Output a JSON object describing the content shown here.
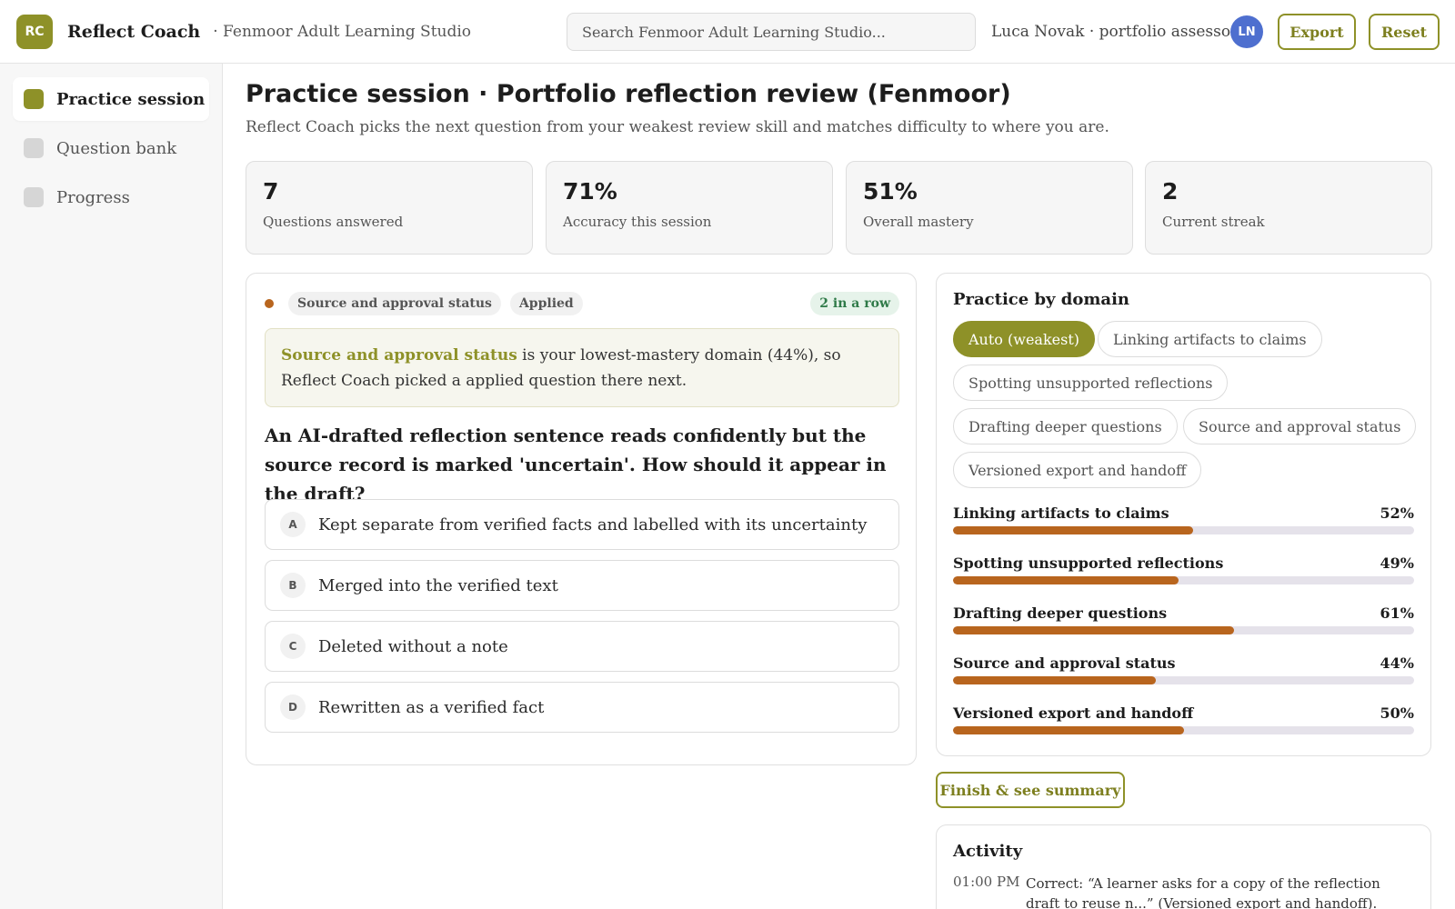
{
  "header": {
    "logo_text": "RC",
    "app_title": "Reflect Coach",
    "org": "· Fenmoor Adult Learning Studio",
    "search_placeholder": "Search Fenmoor Adult Learning Studio...",
    "user": "Luca Novak · portfolio assessor",
    "avatar": "LN",
    "export_label": "Export",
    "reset_label": "Reset"
  },
  "sidebar": {
    "items": [
      {
        "label": "Practice session",
        "icon": "practice-icon",
        "active": true
      },
      {
        "label": "Question bank",
        "icon": "bank-icon",
        "active": false
      },
      {
        "label": "Progress",
        "icon": "progress-icon",
        "active": false
      }
    ]
  },
  "page": {
    "title": "Practice session · Portfolio reflection review (Fenmoor)",
    "subtitle": "Reflect Coach picks the next question from your weakest review skill and matches difficulty to where you are."
  },
  "stats": [
    {
      "value": "7",
      "label": "Questions answered"
    },
    {
      "value": "71%",
      "label": "Accuracy this session"
    },
    {
      "value": "51%",
      "label": "Overall mastery"
    },
    {
      "value": "2",
      "label": "Current streak"
    }
  ],
  "question": {
    "domain_chip": "Source and approval status",
    "level_chip": "Applied",
    "streak": "2 in a row",
    "reason_highlight": "Source and approval status",
    "reason_rest": " is your lowest-mastery domain (44%), so Reflect Coach picked a applied question there next.",
    "text": "An AI-drafted reflection sentence reads confidently but the source record is marked 'uncertain'. How should it appear in the draft?",
    "options": [
      {
        "letter": "A",
        "text": "Kept separate from verified facts and labelled with its uncertainty"
      },
      {
        "letter": "B",
        "text": "Merged into the verified text"
      },
      {
        "letter": "C",
        "text": "Deleted without a note"
      },
      {
        "letter": "D",
        "text": "Rewritten as a verified fact"
      }
    ]
  },
  "domains": {
    "title": "Practice by domain",
    "filters": [
      {
        "label": "Auto (weakest)",
        "active": true
      },
      {
        "label": "Linking artifacts to claims",
        "active": false
      },
      {
        "label": "Spotting unsupported reflections",
        "active": false
      },
      {
        "label": "Drafting deeper questions",
        "active": false
      },
      {
        "label": "Source and approval status",
        "active": false
      },
      {
        "label": "Versioned export and handoff",
        "active": false
      }
    ],
    "mastery": [
      {
        "name": "Linking artifacts to claims",
        "pct_label": "52%",
        "value": 52
      },
      {
        "name": "Spotting unsupported reflections",
        "pct_label": "49%",
        "value": 49
      },
      {
        "name": "Drafting deeper questions",
        "pct_label": "61%",
        "value": 61
      },
      {
        "name": "Source and approval status",
        "pct_label": "44%",
        "value": 44
      },
      {
        "name": "Versioned export and handoff",
        "pct_label": "50%",
        "value": 50
      }
    ]
  },
  "finish_label": "Finish & see summary",
  "activity": {
    "title": "Activity",
    "items": [
      {
        "time": "01:00 PM",
        "text": "Correct: “A learner asks for a copy of the reflection draft to reuse n...” (Versioned export and handoff)."
      }
    ]
  },
  "colors": {
    "accent": "#8e9128",
    "bar": "#b8651e",
    "avatar": "#4e6fcf",
    "streak_bg": "#e6f3ea",
    "streak_text": "#2f7a48"
  }
}
